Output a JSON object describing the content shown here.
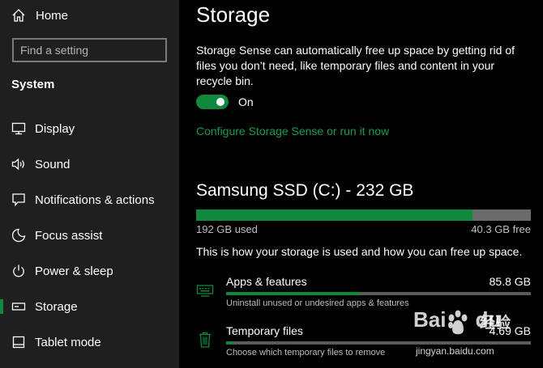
{
  "sidebar": {
    "home_label": "Home",
    "search_placeholder": "Find a setting",
    "section_title": "System",
    "items": [
      {
        "label": "Display",
        "icon": "monitor-icon"
      },
      {
        "label": "Sound",
        "icon": "speaker-icon"
      },
      {
        "label": "Notifications & actions",
        "icon": "message-icon"
      },
      {
        "label": "Focus assist",
        "icon": "moon-icon"
      },
      {
        "label": "Power & sleep",
        "icon": "power-icon"
      },
      {
        "label": "Storage",
        "icon": "storage-icon",
        "active": true
      },
      {
        "label": "Tablet mode",
        "icon": "tablet-icon"
      }
    ]
  },
  "main": {
    "title": "Storage",
    "description": "Storage Sense can automatically free up space by getting rid of files you don’t need, like temporary files and content in your recycle bin.",
    "toggle_label": "On",
    "configure_link": "Configure Storage Sense or run it now",
    "drive_title": "Samsung SSD (C:) - 232 GB",
    "drive_used_fraction": 0.826,
    "used_label": "192 GB used",
    "free_label": "40.3 GB free",
    "info_text": "This is how your storage is used and how you can free up space.",
    "categories": [
      {
        "name": "Apps & features",
        "size": "85.8 GB",
        "fraction": 0.44,
        "subtitle": "Uninstall unused or undesired apps & features",
        "icon": "apps-icon"
      },
      {
        "name": "Temporary files",
        "size": "4.69 GB",
        "fraction": 0.02,
        "subtitle": "Choose which temporary files to remove",
        "icon": "trash-icon"
      }
    ]
  },
  "colors": {
    "accent": "#10893e",
    "link": "#179e4e",
    "sidebar_bg": "#1f1f1f",
    "main_bg": "#000000"
  },
  "watermark": {
    "logo_text": "Bai du",
    "brand_text": "经验",
    "url": "jingyan.baidu.com"
  }
}
